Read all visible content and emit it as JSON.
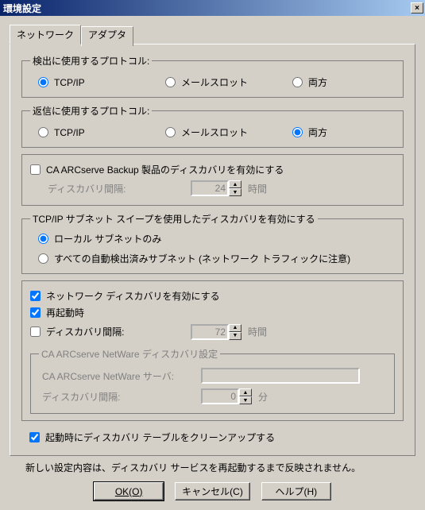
{
  "window": {
    "title": "環境設定",
    "close_x": "×"
  },
  "tabs": {
    "network": "ネットワーク",
    "adapter": "アダプタ"
  },
  "detect_proto": {
    "legend": "検出に使用するプロトコル:",
    "tcpip": "TCP/IP",
    "mailslot": "メールスロット",
    "both": "両方"
  },
  "reply_proto": {
    "legend": "返信に使用するプロトコル:",
    "tcpip": "TCP/IP",
    "mailslot": "メールスロット",
    "both": "両方"
  },
  "arcserve": {
    "enable_label": "CA ARCserve Backup 製品のディスカバリを有効にする",
    "interval_label": "ディスカバリ間隔:",
    "interval_value": "24",
    "interval_unit": "時間"
  },
  "tcpip_sweep": {
    "legend": "TCP/IP サブネット スイープを使用したディスカバリを有効にする",
    "local": "ローカル サブネットのみ",
    "all": "すべての自動検出済みサブネット (ネットワーク トラフィックに注意)"
  },
  "net_disc": {
    "enable": "ネットワーク ディスカバリを有効にする",
    "onrestart": "再起動時",
    "interval_label": "ディスカバリ間隔:",
    "interval_value": "72",
    "interval_unit": "時間"
  },
  "netware": {
    "legend": "CA ARCserve NetWare ディスカバリ設定",
    "server_label": "CA ARCserve NetWare サーバ:",
    "interval_label": "ディスカバリ間隔:",
    "interval_value": "0",
    "interval_unit": "分"
  },
  "cleanup": {
    "label": "起動時にディスカバリ テーブルをクリーンアップする"
  },
  "note": "新しい設定内容は、ディスカバリ サービスを再起動するまで反映されません。",
  "buttons": {
    "ok": "OK(O)",
    "cancel": "キャンセル(C)",
    "help": "ヘルプ(H)"
  }
}
